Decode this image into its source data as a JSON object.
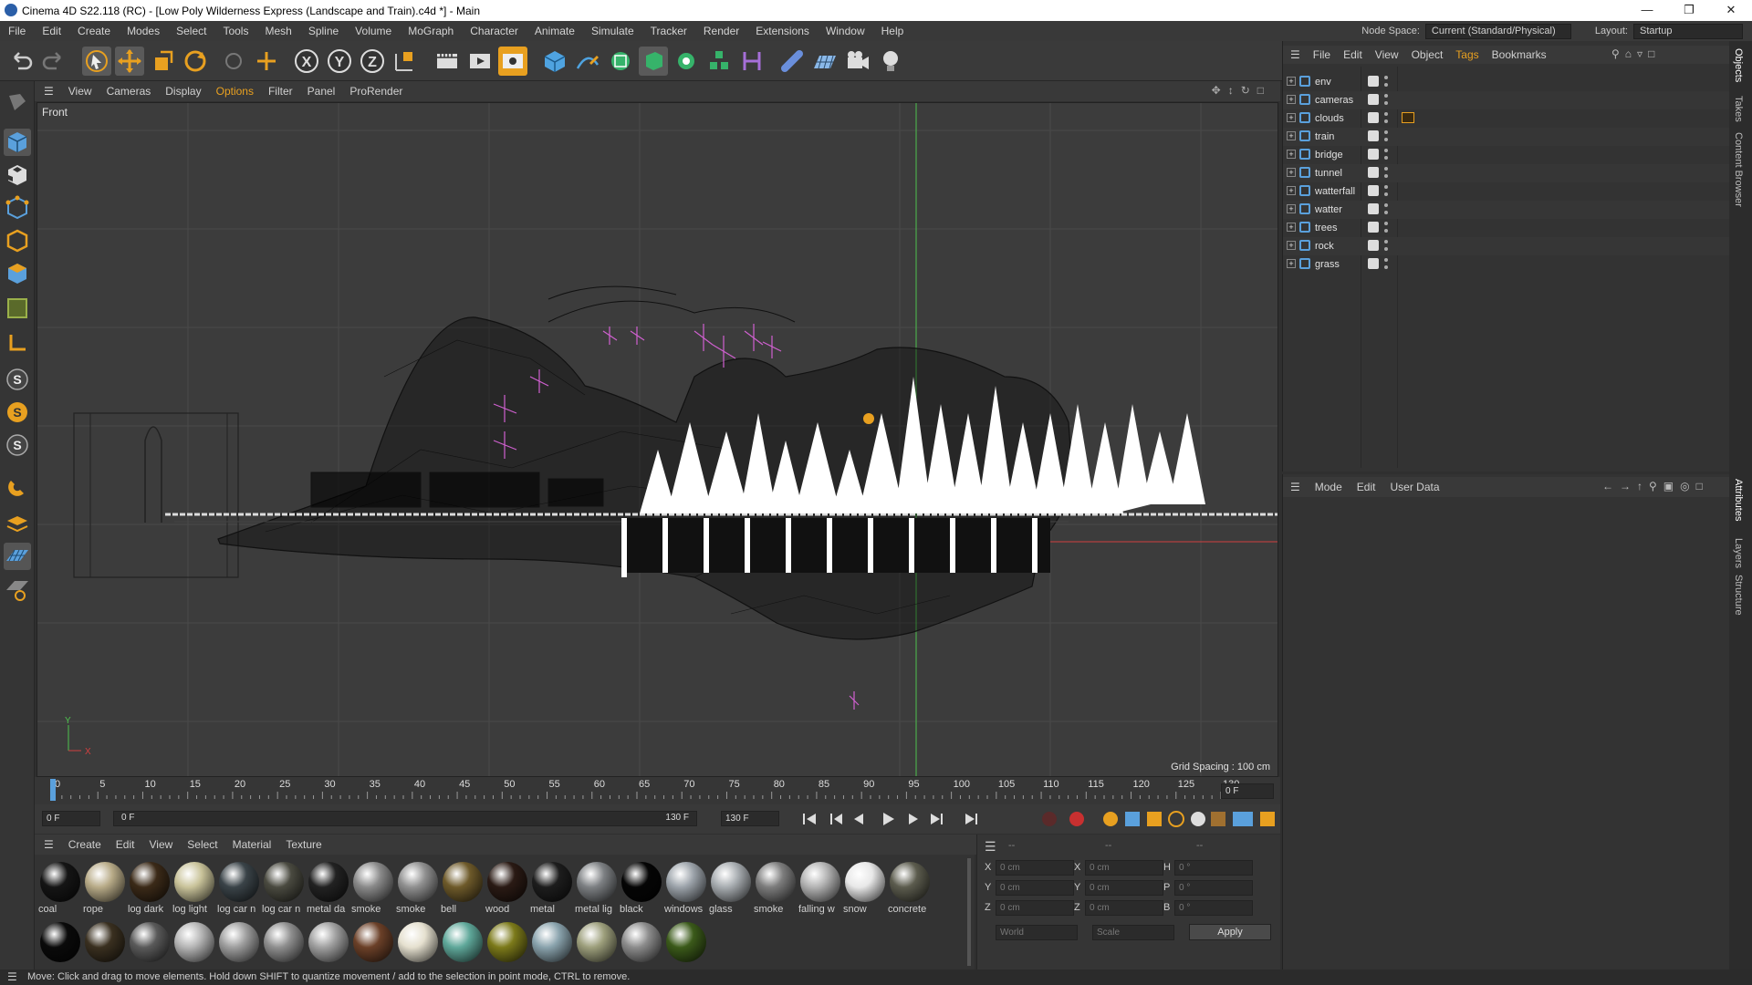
{
  "window": {
    "title": "Cinema 4D S22.118 (RC) - [Low Poly Wilderness Express (Landscape and Train).c4d *] - Main"
  },
  "menubar": {
    "items": [
      "File",
      "Edit",
      "Create",
      "Modes",
      "Select",
      "Tools",
      "Mesh",
      "Spline",
      "Volume",
      "MoGraph",
      "Character",
      "Animate",
      "Simulate",
      "Tracker",
      "Render",
      "Extensions",
      "Window",
      "Help"
    ],
    "node_space_label": "Node Space:",
    "node_space_value": "Current (Standard/Physical)",
    "layout_label": "Layout:",
    "layout_value": "Startup"
  },
  "viewport_menu": {
    "items": [
      "View",
      "Cameras",
      "Display",
      "Options",
      "Filter",
      "Panel",
      "ProRender"
    ],
    "active": "Options"
  },
  "viewport": {
    "view_label": "Front",
    "grid_spacing": "Grid Spacing : 100 cm",
    "axis_y": "Y",
    "axis_x": "X"
  },
  "timeline": {
    "ticks": [
      "0",
      "5",
      "10",
      "15",
      "20",
      "25",
      "30",
      "35",
      "40",
      "45",
      "50",
      "55",
      "60",
      "65",
      "70",
      "75",
      "80",
      "85",
      "90",
      "95",
      "100",
      "105",
      "110",
      "115",
      "120",
      "125",
      "130"
    ],
    "current_frame": "0 F"
  },
  "playbar": {
    "start": "0 F",
    "range_start": "0 F",
    "range_end": "130 F",
    "end": "130 F"
  },
  "material_menu": {
    "items": [
      "Create",
      "Edit",
      "View",
      "Select",
      "Material",
      "Texture"
    ]
  },
  "materials_row1": [
    {
      "name": "coal",
      "color": "#151515"
    },
    {
      "name": "rope",
      "color": "#b8ab88"
    },
    {
      "name": "log dark",
      "color": "#3b2a18"
    },
    {
      "name": "log light",
      "color": "#c9c39a"
    },
    {
      "name": "log car n",
      "color": "#3a4348"
    },
    {
      "name": "log car n",
      "color": "#4a4a40"
    },
    {
      "name": "metal da",
      "color": "#222222"
    },
    {
      "name": "smoke",
      "color": "#8a8a8a"
    },
    {
      "name": "smoke",
      "color": "#909090"
    },
    {
      "name": "bell",
      "color": "#6e5a2a"
    },
    {
      "name": "wood",
      "color": "#2a1a14"
    },
    {
      "name": "metal",
      "color": "#1d1d1d"
    },
    {
      "name": "metal lig",
      "color": "#7d8083"
    },
    {
      "name": "black",
      "color": "#050505"
    },
    {
      "name": "windows",
      "color": "#9ca3aa"
    },
    {
      "name": "glass",
      "color": "#a8adb1"
    },
    {
      "name": "smoke",
      "color": "#7d7d7d"
    },
    {
      "name": "falling w",
      "color": "#b3b3b3"
    },
    {
      "name": "snow",
      "color": "#e8e8e8"
    },
    {
      "name": "concrete",
      "color": "#5c5c4e"
    }
  ],
  "materials_row2": [
    {
      "color": "#0a0a0a"
    },
    {
      "color": "#3a3020"
    },
    {
      "color": "#5a5a5a"
    },
    {
      "color": "#b5b5b5"
    },
    {
      "color": "#9e9e9e"
    },
    {
      "color": "#8f8f8f"
    },
    {
      "color": "#a0a0a0"
    },
    {
      "color": "#6b4028"
    },
    {
      "color": "#e5e0cf"
    },
    {
      "color": "#5fa89a"
    },
    {
      "color": "#7c7a1a"
    },
    {
      "color": "#8aa3ad"
    },
    {
      "color": "#9d9f7c"
    },
    {
      "color": "#8c8c8c"
    },
    {
      "color": "#3b5a1a"
    }
  ],
  "coords": {
    "header": [
      "--",
      "--",
      "--"
    ],
    "rows": [
      {
        "a": "X",
        "av": "0 cm",
        "b": "X",
        "bv": "0 cm",
        "c": "H",
        "cv": "0 °"
      },
      {
        "a": "Y",
        "av": "0 cm",
        "b": "Y",
        "bv": "0 cm",
        "c": "P",
        "cv": "0 °"
      },
      {
        "a": "Z",
        "av": "0 cm",
        "b": "Z",
        "bv": "0 cm",
        "c": "B",
        "cv": "0 °"
      }
    ],
    "space": "World",
    "mode": "Scale",
    "apply": "Apply"
  },
  "object_menu": {
    "items": [
      "File",
      "Edit",
      "View",
      "Object",
      "Tags",
      "Bookmarks"
    ],
    "active": "Tags"
  },
  "objects": [
    "env",
    "cameras",
    "clouds",
    "train",
    "bridge",
    "tunnel",
    "watterfall",
    "watter",
    "trees",
    "rock",
    "grass"
  ],
  "attr_menu": {
    "items": [
      "Mode",
      "Edit",
      "User Data"
    ]
  },
  "sidetabs": [
    "Objects",
    "Takes",
    "Content Browser",
    "Attributes",
    "Layers",
    "Structure"
  ],
  "status": "Move: Click and drag to move elements. Hold down SHIFT to quantize movement / add to the selection in point mode, CTRL to remove.",
  "colors": {
    "accent_orange": "#e8a020",
    "axis_green": "#4ec24e",
    "axis_red": "#d04040",
    "tags_color": "#e8a020"
  }
}
